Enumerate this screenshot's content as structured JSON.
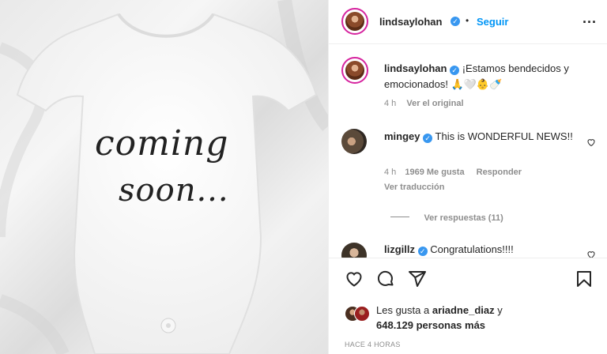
{
  "photo": {
    "text_line1": "coming",
    "text_line2": "soon..."
  },
  "header": {
    "username": "lindsaylohan",
    "dot": "•",
    "follow_label": "Seguir",
    "more_label": "..."
  },
  "caption": {
    "username": "lindsaylohan",
    "text": "¡Estamos bendecidos y emocionados! 🙏🤍👶🍼",
    "time": "4 h",
    "see_original": "Ver el original"
  },
  "comments": [
    {
      "username": "mingey",
      "text": "This is WONDERFUL NEWS!!",
      "time": "4 h",
      "likes": "1969 Me gusta",
      "reply": "Responder",
      "translate": "Ver traducción",
      "view_replies": "Ver respuestas (11)"
    },
    {
      "username": "lizgillz",
      "text": "Congratulations!!!!"
    }
  ],
  "likes": {
    "prefix": "Les gusta a",
    "user": "ariadne_diaz",
    "suffix": "y",
    "count": "648.129 personas más"
  },
  "timestamp": "HACE 4 HORAS",
  "colors": {
    "link": "#0095f6",
    "verified": "#3897f0",
    "muted": "#8e8e8e"
  }
}
